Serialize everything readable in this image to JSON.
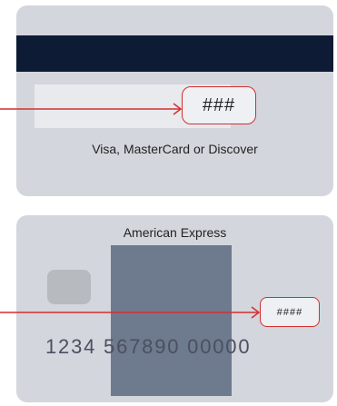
{
  "back_card": {
    "cvv_placeholder": "###",
    "caption": "Visa, MasterCard or Discover"
  },
  "front_card": {
    "brand": "American Express",
    "cvv_placeholder": "####",
    "card_number": "1234 567890 00000"
  },
  "colors": {
    "card": "#d3d6dc",
    "magnetic_stripe": "#0d1b35",
    "highlight": "#d32f2f",
    "overlay": "#6e7a8e"
  }
}
